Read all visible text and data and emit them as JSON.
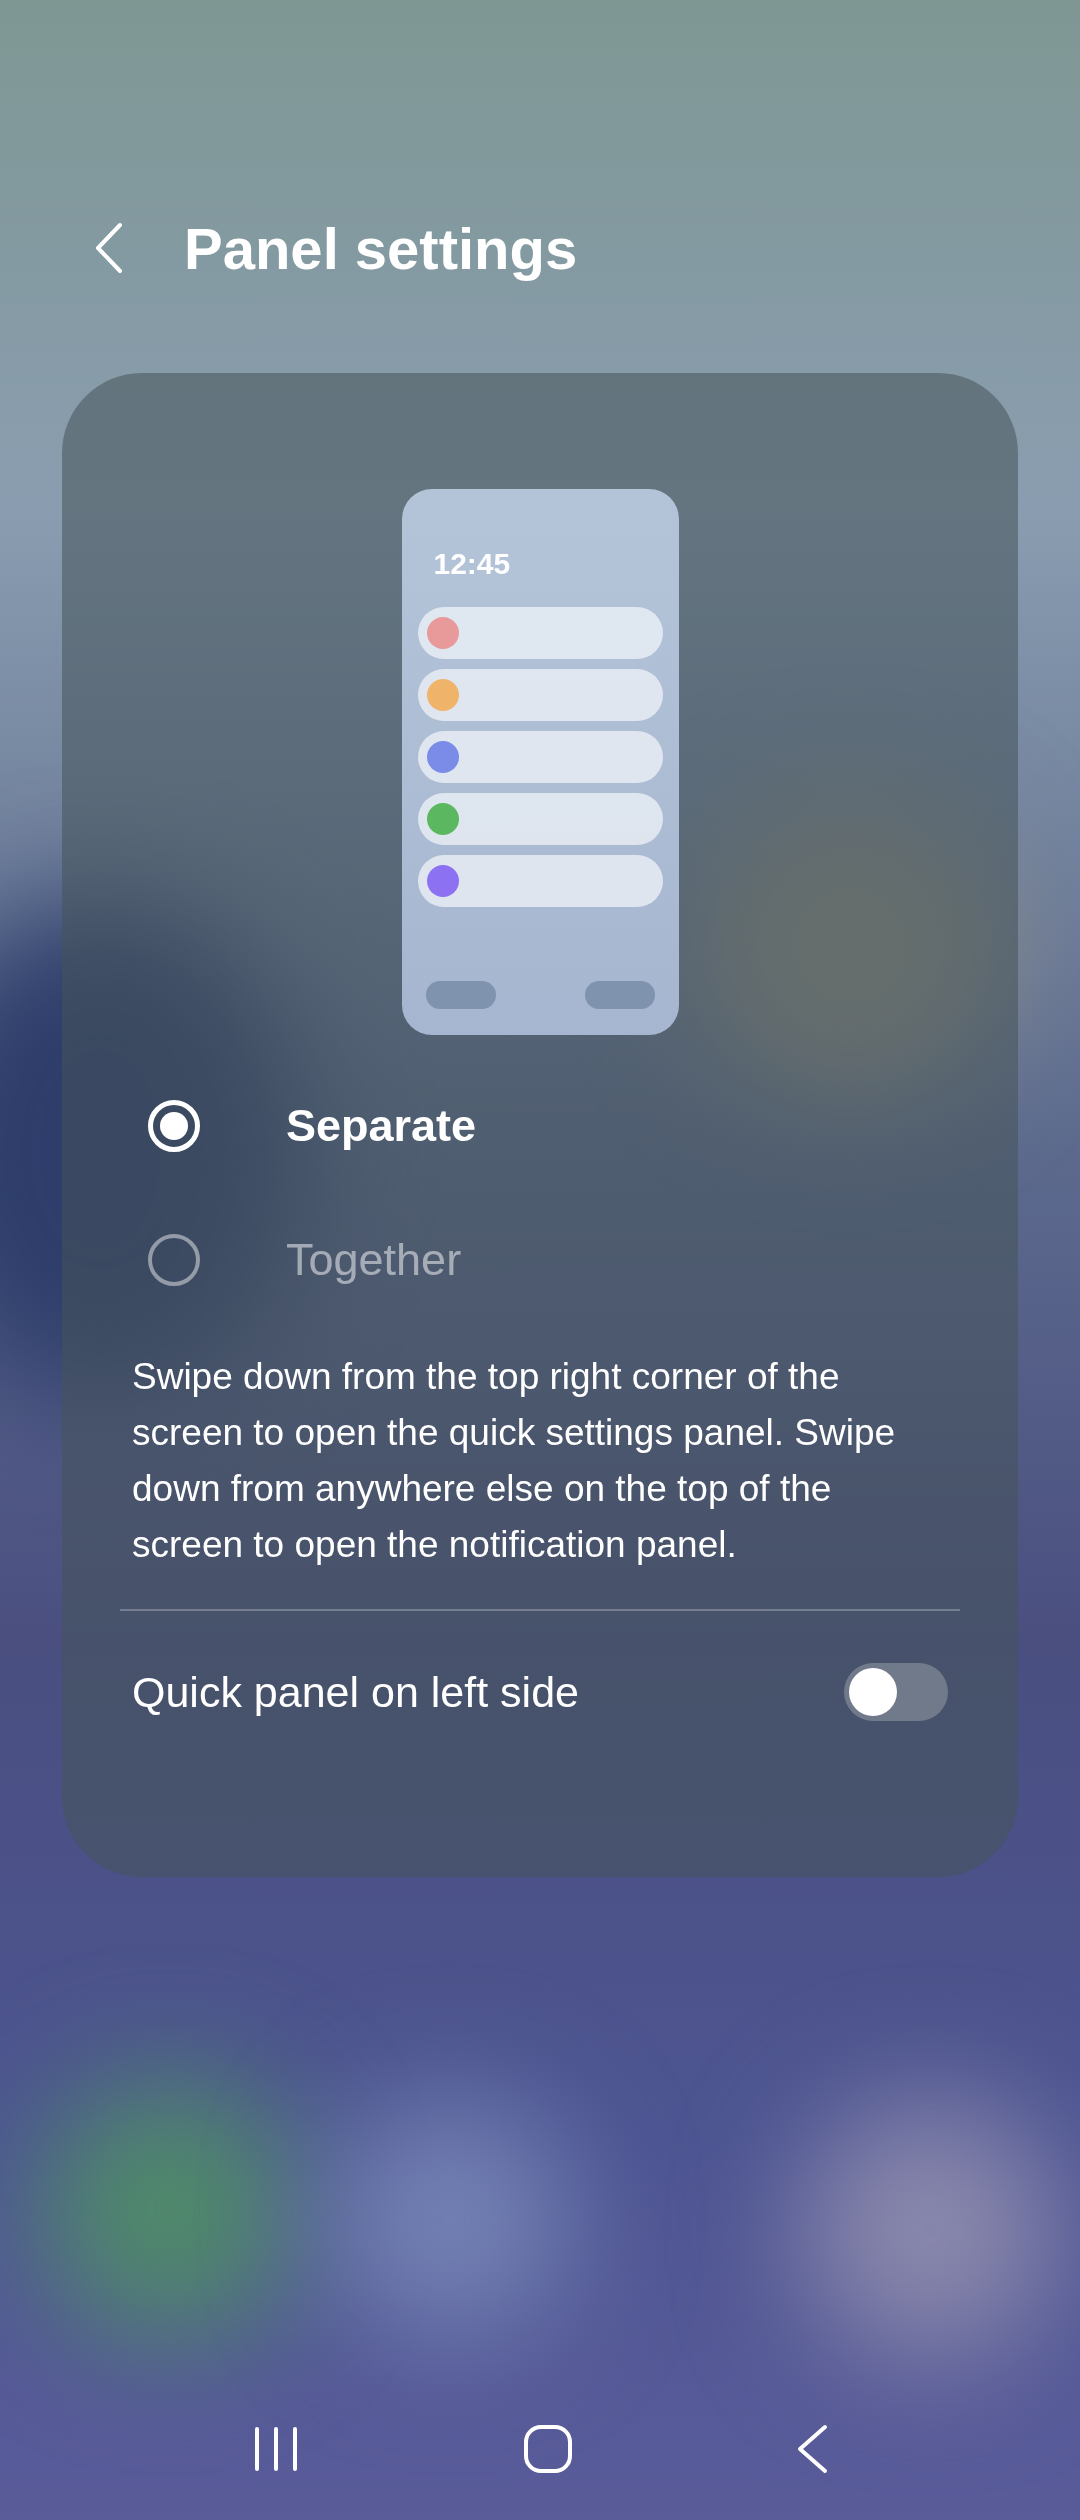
{
  "header": {
    "title": "Panel settings"
  },
  "preview": {
    "time": "12:45",
    "rows": [
      {
        "color": "#e89a9a"
      },
      {
        "color": "#f0b36a"
      },
      {
        "color": "#7a8be8"
      },
      {
        "color": "#5cb860"
      },
      {
        "color": "#8c72f2"
      }
    ]
  },
  "options": [
    {
      "label": "Separate",
      "selected": true
    },
    {
      "label": "Together",
      "selected": false
    }
  ],
  "description": "Swipe down from the top right corner of the screen to open the quick settings panel. Swipe down from anywhere else on the top of the screen to open the notification panel.",
  "toggle": {
    "label": "Quick panel on left side",
    "on": false
  }
}
